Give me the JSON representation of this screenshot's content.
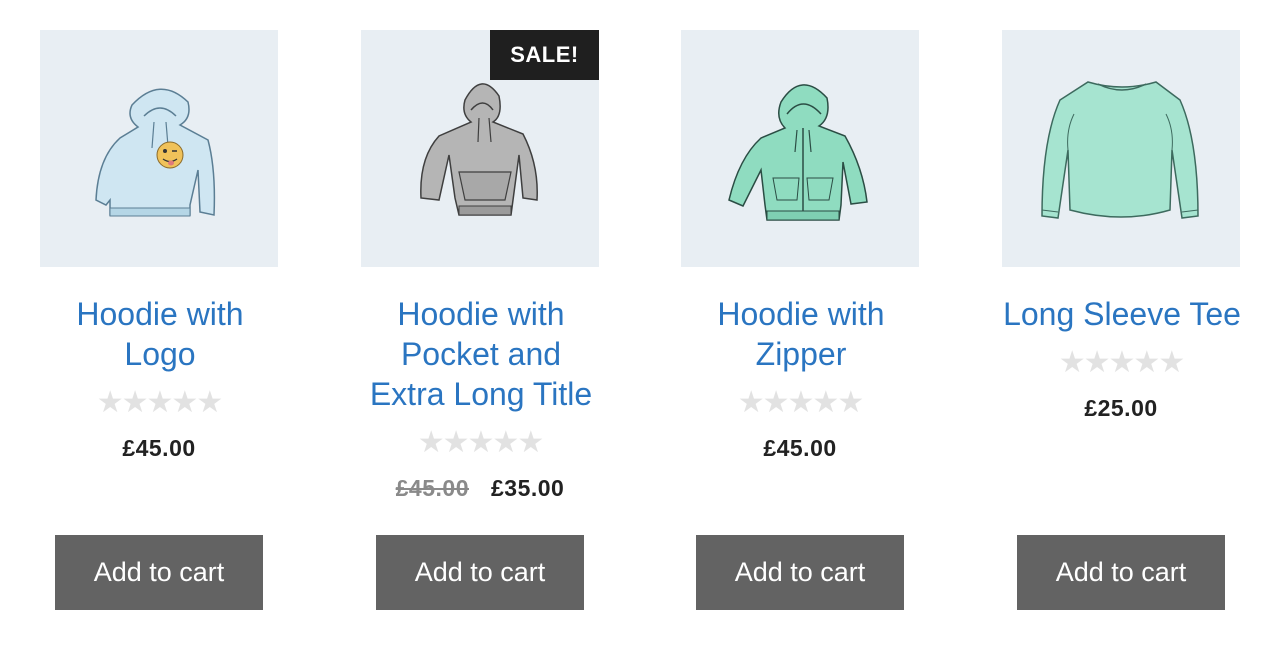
{
  "products": [
    {
      "title": "Hoodie with Logo",
      "title_lines": [
        "Hoodie with",
        "Logo"
      ],
      "rating_stars": "★★★★★",
      "price": "£45.00",
      "button_label": "Add to cart",
      "image": "hoodie-with-logo-icon"
    },
    {
      "title": "Hoodie with Pocket and Extra Long Title",
      "title_lines": [
        "Hoodie with",
        "Pocket and",
        "Extra Long Title"
      ],
      "badge": "SALE!",
      "rating_stars": "★★★★★",
      "old_price": "£45.00",
      "price": "£35.00",
      "button_label": "Add to cart",
      "image": "grey-hoodie-with-pocket-icon"
    },
    {
      "title": "Hoodie with Zipper",
      "title_lines": [
        "Hoodie with",
        "Zipper"
      ],
      "rating_stars": "★★★★★",
      "price": "£45.00",
      "button_label": "Add to cart",
      "image": "green-zip-hoodie-icon"
    },
    {
      "title": "Long Sleeve Tee",
      "title_lines": [
        "Long Sleeve Tee"
      ],
      "rating_stars": "★★★★★",
      "price": "£25.00",
      "button_label": "Add to cart",
      "image": "long-sleeve-tee-icon"
    }
  ],
  "colors": {
    "link": "#2a75c1",
    "button": "#636363",
    "badge": "#1f1f1f",
    "image_bg": "#e8eef3",
    "star_empty": "#e2e2e2"
  }
}
